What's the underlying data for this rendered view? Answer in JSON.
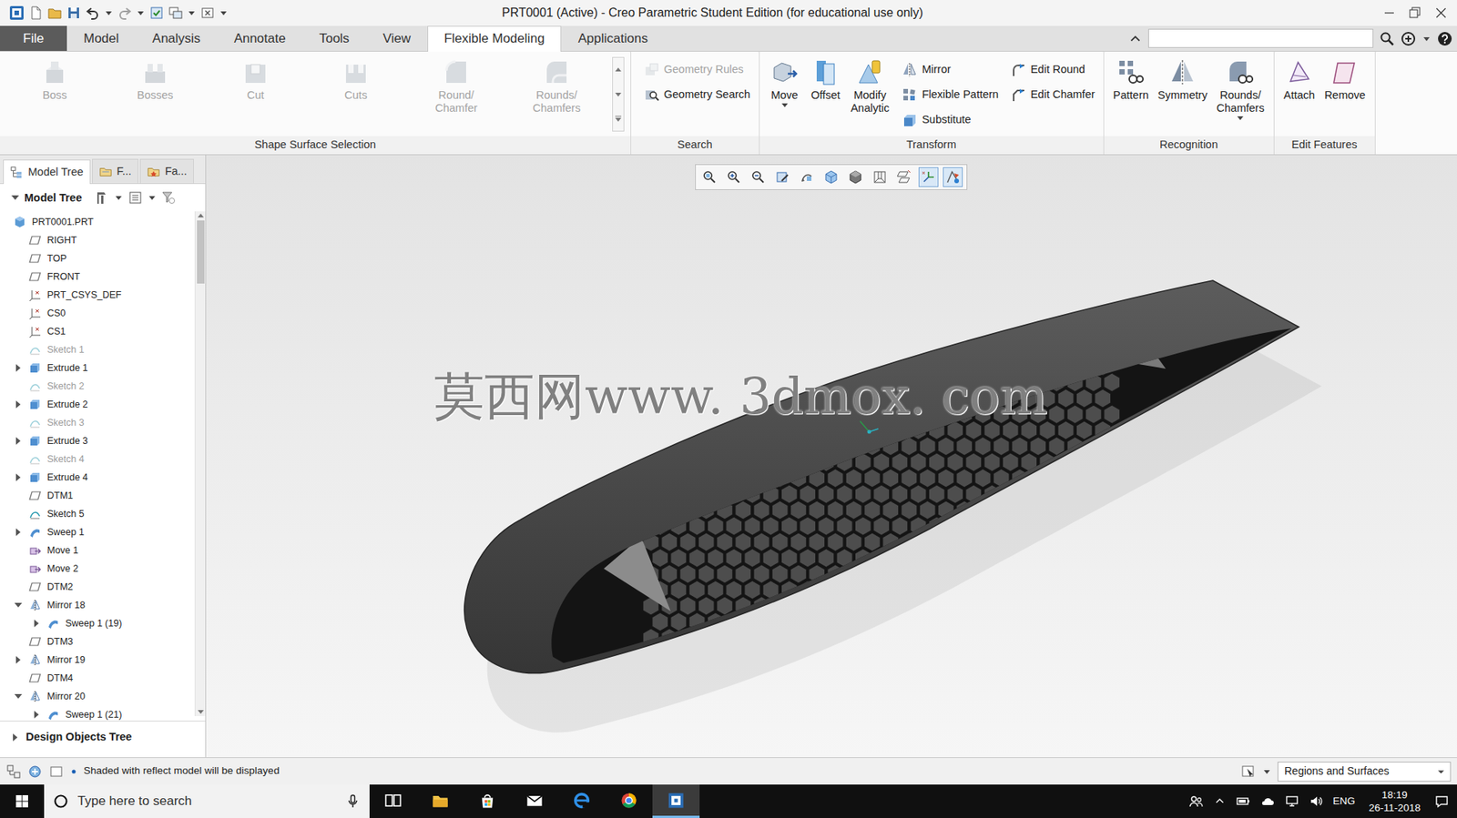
{
  "window": {
    "title": "PRT0001 (Active) - Creo Parametric Student Edition (for educational use only)"
  },
  "file_menu": {
    "label": "File"
  },
  "ribbon_tabs": [
    {
      "label": "Model",
      "selected": false
    },
    {
      "label": "Analysis",
      "selected": false
    },
    {
      "label": "Annotate",
      "selected": false
    },
    {
      "label": "Tools",
      "selected": false
    },
    {
      "label": "View",
      "selected": false
    },
    {
      "label": "Flexible Modeling",
      "selected": true
    },
    {
      "label": "Applications",
      "selected": false
    }
  ],
  "ribbon_groups": [
    {
      "label": "Shape Surface Selection",
      "gallery_scroll": true,
      "controls": [
        {
          "kind": "large",
          "label": "Boss",
          "disabled": true,
          "dropdown": false
        },
        {
          "kind": "large",
          "label": "Bosses",
          "disabled": true,
          "dropdown": false
        },
        {
          "kind": "large",
          "label": "Cut",
          "disabled": true,
          "dropdown": false
        },
        {
          "kind": "large",
          "label": "Cuts",
          "disabled": true,
          "dropdown": false
        },
        {
          "kind": "large",
          "label": "Round/ Chamfer",
          "disabled": true,
          "dropdown": false
        },
        {
          "kind": "large",
          "label": "Rounds/ Chamfers",
          "disabled": true,
          "dropdown": false
        }
      ]
    },
    {
      "label": "Search",
      "gallery_scroll": false,
      "controls": [
        {
          "kind": "small",
          "label": "Geometry Rules",
          "disabled": true,
          "dropdown": false
        },
        {
          "kind": "small",
          "label": "Geometry Search",
          "disabled": false,
          "dropdown": false
        }
      ]
    },
    {
      "label": "Transform",
      "gallery_scroll": false,
      "controls": [
        {
          "kind": "large",
          "label": "Move",
          "disabled": false,
          "dropdown": true
        },
        {
          "kind": "large",
          "label": "Offset",
          "disabled": false,
          "dropdown": false
        },
        {
          "kind": "large",
          "label": "Modify Analytic",
          "disabled": false,
          "dropdown": false
        },
        {
          "kind": "small",
          "label": "Mirror",
          "disabled": false,
          "dropdown": false
        },
        {
          "kind": "small",
          "label": "Flexible Pattern",
          "disabled": false,
          "dropdown": false
        },
        {
          "kind": "small",
          "label": "Substitute",
          "disabled": false,
          "dropdown": false
        },
        {
          "kind": "small",
          "label": "Edit Round",
          "disabled": false,
          "dropdown": false
        },
        {
          "kind": "small",
          "label": "Edit Chamfer",
          "disabled": false,
          "dropdown": false
        }
      ]
    },
    {
      "label": "Recognition",
      "gallery_scroll": false,
      "controls": [
        {
          "kind": "large",
          "label": "Pattern",
          "disabled": false,
          "dropdown": false
        },
        {
          "kind": "large",
          "label": "Symmetry",
          "disabled": false,
          "dropdown": false
        },
        {
          "kind": "large",
          "label": "Rounds/ Chamfers",
          "disabled": false,
          "dropdown": true
        }
      ]
    },
    {
      "label": "Edit Features",
      "gallery_scroll": false,
      "controls": [
        {
          "kind": "large",
          "label": "Attach",
          "disabled": false,
          "dropdown": false
        },
        {
          "kind": "large",
          "label": "Remove",
          "disabled": false,
          "dropdown": false
        }
      ]
    }
  ],
  "panel_tabs": [
    {
      "label": "Model Tree",
      "selected": true
    },
    {
      "label": "F...",
      "selected": false
    },
    {
      "label": "Fa...",
      "selected": false
    }
  ],
  "model_tree": {
    "header": {
      "label": "Model Tree",
      "expanded": true
    },
    "root": {
      "label": "PRT0001.PRT",
      "kind": "part",
      "dimmed": false
    },
    "items": [
      {
        "label": "RIGHT",
        "kind": "plane",
        "expander": "none",
        "dimmed": false
      },
      {
        "label": "TOP",
        "kind": "plane",
        "expander": "none",
        "dimmed": false
      },
      {
        "label": "FRONT",
        "kind": "plane",
        "expander": "none",
        "dimmed": false
      },
      {
        "label": "PRT_CSYS_DEF",
        "kind": "csys",
        "expander": "none",
        "dimmed": false
      },
      {
        "label": "CS0",
        "kind": "csys",
        "expander": "none",
        "dimmed": false
      },
      {
        "label": "CS1",
        "kind": "csys",
        "expander": "none",
        "dimmed": false
      },
      {
        "label": "Sketch 1",
        "kind": "sketch",
        "expander": "none",
        "dimmed": true
      },
      {
        "label": "Extrude 1",
        "kind": "extrude",
        "expander": "closed",
        "dimmed": false
      },
      {
        "label": "Sketch 2",
        "kind": "sketch",
        "expander": "none",
        "dimmed": true
      },
      {
        "label": "Extrude 2",
        "kind": "extrude",
        "expander": "closed",
        "dimmed": false
      },
      {
        "label": "Sketch 3",
        "kind": "sketch",
        "expander": "none",
        "dimmed": true
      },
      {
        "label": "Extrude 3",
        "kind": "extrude",
        "expander": "closed",
        "dimmed": false
      },
      {
        "label": "Sketch 4",
        "kind": "sketch",
        "expander": "none",
        "dimmed": true
      },
      {
        "label": "Extrude 4",
        "kind": "extrude",
        "expander": "closed",
        "dimmed": false
      },
      {
        "label": "DTM1",
        "kind": "plane",
        "expander": "none",
        "dimmed": false
      },
      {
        "label": "Sketch 5",
        "kind": "sketch",
        "expander": "none",
        "dimmed": false
      },
      {
        "label": "Sweep 1",
        "kind": "sweep",
        "expander": "closed",
        "dimmed": false
      },
      {
        "label": "Move 1",
        "kind": "move",
        "expander": "none",
        "dimmed": false
      },
      {
        "label": "Move 2",
        "kind": "move",
        "expander": "none",
        "dimmed": false
      },
      {
        "label": "DTM2",
        "kind": "plane",
        "expander": "none",
        "dimmed": false
      },
      {
        "label": "Mirror 18",
        "kind": "mirror",
        "expander": "open",
        "dimmed": false,
        "children": [
          {
            "label": "Sweep 1 (19)",
            "kind": "sweep",
            "expander": "closed",
            "dimmed": false
          }
        ]
      },
      {
        "label": "DTM3",
        "kind": "plane",
        "expander": "none",
        "dimmed": false
      },
      {
        "label": "Mirror 19",
        "kind": "mirror",
        "expander": "closed",
        "dimmed": false
      },
      {
        "label": "DTM4",
        "kind": "plane",
        "expander": "none",
        "dimmed": false
      },
      {
        "label": "Mirror 20",
        "kind": "mirror",
        "expander": "open",
        "dimmed": false,
        "children": [
          {
            "label": "Sweep 1 (21)",
            "kind": "sweep",
            "expander": "closed",
            "dimmed": false
          }
        ]
      }
    ],
    "scrollbar": {
      "level": 0.13
    },
    "footer": {
      "label": "Design Objects Tree",
      "expanded": false
    }
  },
  "view_toolbar": [
    {
      "pressed": false
    },
    {
      "pressed": false
    },
    {
      "pressed": false
    },
    {
      "pressed": false
    },
    {
      "pressed": false
    },
    {
      "pressed": false
    },
    {
      "pressed": false
    },
    {
      "pressed": false
    },
    {
      "pressed": false
    },
    {
      "pressed": true
    },
    {
      "pressed": true
    }
  ],
  "viewport": {
    "watermark": "莫西网www. 3dmox. com"
  },
  "status_bar": {
    "message": "Shaded with reflect model will be displayed",
    "filter": "Regions and Surfaces"
  },
  "taskbar": {
    "search_placeholder": "Type here to search",
    "apps": [
      {
        "active": false
      },
      {
        "active": false
      },
      {
        "active": false
      },
      {
        "active": false
      },
      {
        "active": false
      },
      {
        "active": false
      },
      {
        "active": true
      }
    ],
    "language": "ENG",
    "time": "18:19",
    "date": "26-11-2018"
  }
}
